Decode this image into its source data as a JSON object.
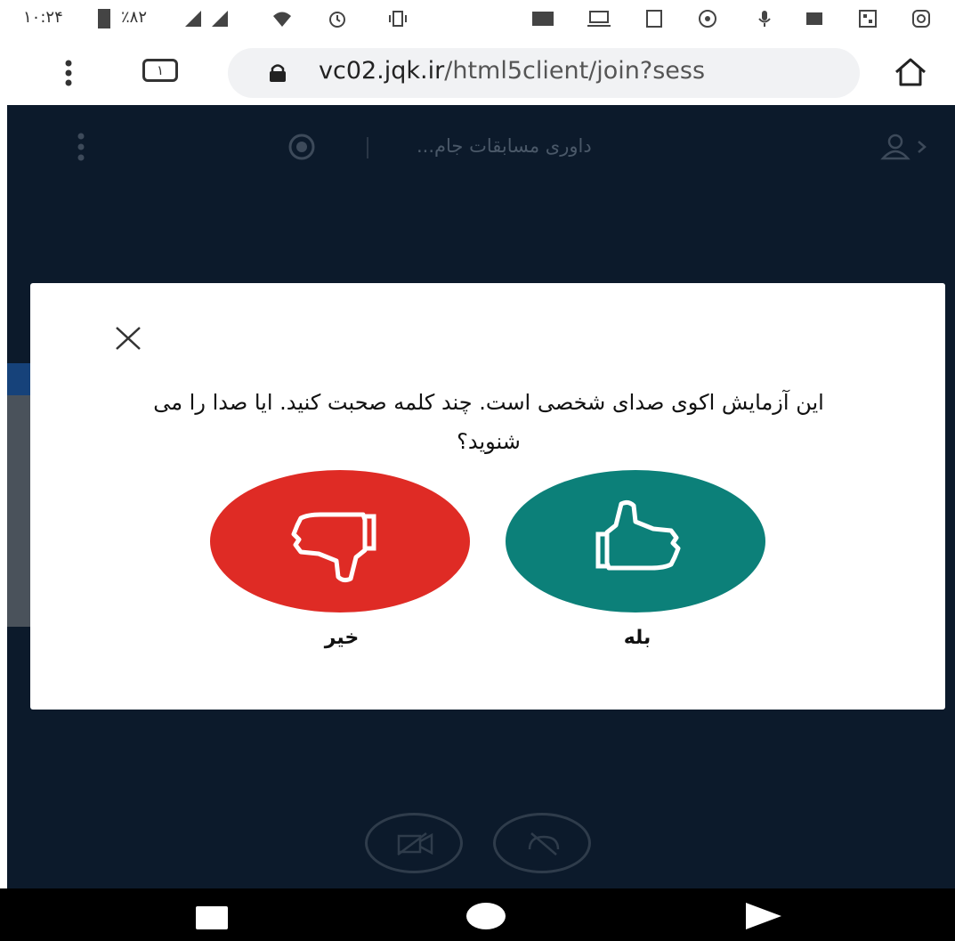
{
  "status_bar": {
    "time": "۱۰:۲۴",
    "battery": "٪۸۲"
  },
  "browser": {
    "tab_count": "۱",
    "url_host": "vc02.jqk.ir",
    "url_path": "/html5client/join?sess"
  },
  "app": {
    "meeting_title": "داوری مسابقات جام..."
  },
  "echo_test_modal": {
    "message": "این آزمایش اکوی صدای شخصی است. چند کلمه صحبت کنید. ایا صدا را می شنوید؟",
    "yes_label": "بله",
    "no_label": "خیر"
  },
  "colors": {
    "yes_button": "#0c8079",
    "no_button": "#df2b25",
    "app_background": "#0c1a2b"
  }
}
